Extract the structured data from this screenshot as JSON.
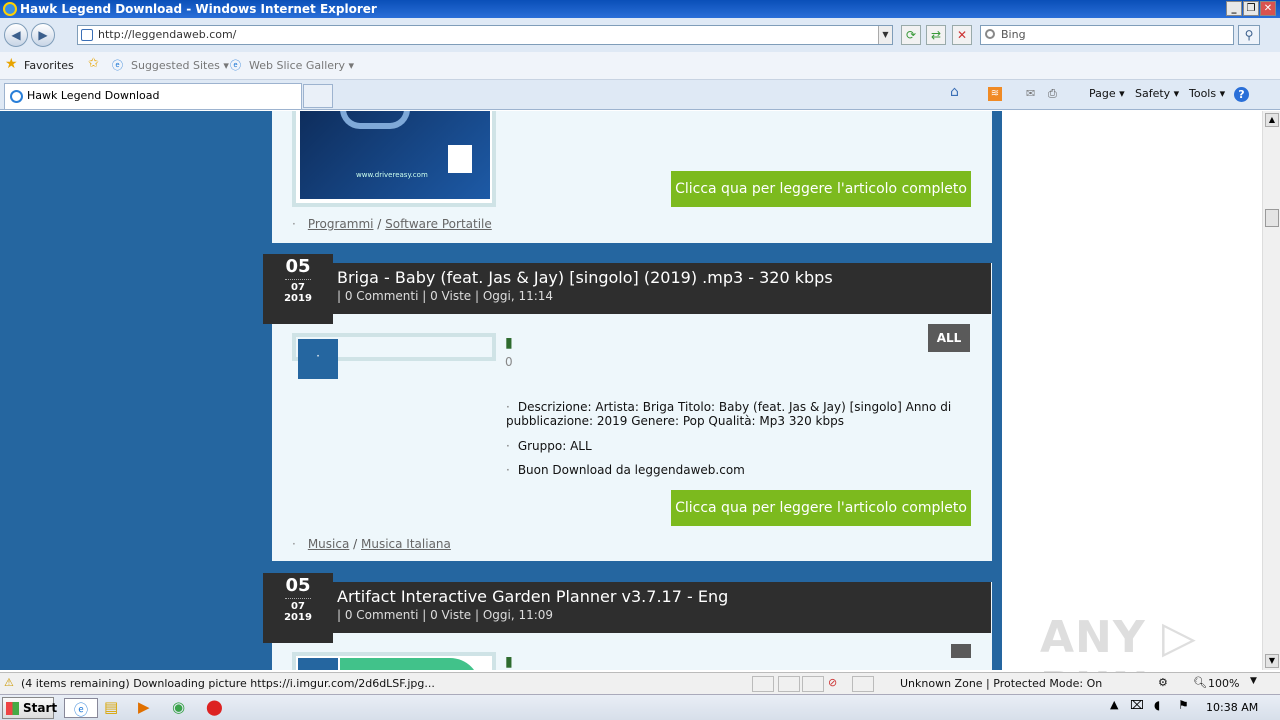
{
  "window": {
    "title": "Hawk Legend Download - Windows Internet Explorer",
    "controls": [
      "_",
      "❐",
      "✕"
    ]
  },
  "nav": {
    "url": "http://leggendaweb.com/",
    "search_placeholder": "Bing"
  },
  "favorites": {
    "favorites_label": "Favorites",
    "suggested_sites": "Suggested Sites ▾",
    "web_slice_gallery": "Web Slice Gallery ▾"
  },
  "tabs": [
    {
      "label": "Hawk Legend Download"
    }
  ],
  "commands": {
    "page": "Page ▾",
    "safety": "Safety ▾",
    "tools": "Tools ▾",
    "help": "?"
  },
  "content": {
    "read_more": "Clicca qua per leggere l'articolo completo",
    "post0": {
      "cat1": "Programmi",
      "cat2": "Software Portatile",
      "box_text": "www.drivereasy.com"
    },
    "post1": {
      "day": "05",
      "month": "07",
      "year": "2019",
      "title": "Briga - Baby (feat. Jas & Jay) [singolo] (2019) .mp3 - 320 kbps",
      "meta": "| 0 Commenti | 0 Viste | Oggi, 11:14",
      "badge": "ALL",
      "likes": "0",
      "desc": "Descrizione: Artista: Briga Titolo: Baby (feat. Jas & Jay) [singolo] Anno di pubblicazione: 2019 Genere: Pop Qualità: Mp3 320 kbps",
      "gruppo": "Gruppo: ALL",
      "download": "Buon Download da leggendaweb.com",
      "cat1": "Musica",
      "cat2": "Musica Italiana"
    },
    "post2": {
      "day": "05",
      "month": "07",
      "year": "2019",
      "title": "Artifact Interactive Garden Planner v3.7.17 - Eng",
      "meta": "| 0 Commenti | 0 Viste | Oggi, 11:09"
    }
  },
  "status": {
    "text": "(4 items remaining) Downloading picture https://i.imgur.com/2d6dLSF.jpg...",
    "zone": "Unknown Zone | Protected Mode: On",
    "zoom": "100%"
  },
  "taskbar": {
    "start": "Start",
    "clock": "10:38 AM"
  },
  "watermark": "ANY ▷ RUN",
  "colors": {
    "page_blue": "#2566a0",
    "green_button": "#7cba1e",
    "header_dark": "#2e2e2e"
  }
}
